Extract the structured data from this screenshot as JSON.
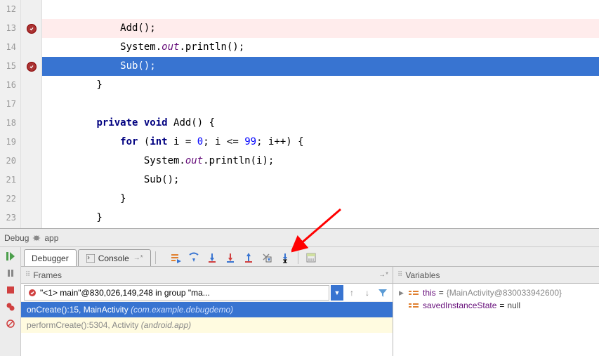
{
  "editor": {
    "lines": [
      {
        "num": 12,
        "text": ""
      },
      {
        "num": 13,
        "text": "            Add();",
        "bp": true
      },
      {
        "num": 14,
        "parts": [
          "            System.",
          {
            "it": "out"
          },
          ".println();"
        ]
      },
      {
        "num": 15,
        "text": "            Sub();",
        "bp": true,
        "exec": true
      },
      {
        "num": 16,
        "text": "        }"
      },
      {
        "num": 17,
        "text": ""
      },
      {
        "num": 18,
        "parts": [
          "        ",
          {
            "kw": "private void"
          },
          " Add() {"
        ]
      },
      {
        "num": 19,
        "parts": [
          "            ",
          {
            "kw": "for"
          },
          " (",
          {
            "kw": "int"
          },
          " i = ",
          {
            "num": "0"
          },
          "; i <= ",
          {
            "num": "99"
          },
          "; i++) {"
        ]
      },
      {
        "num": 20,
        "parts": [
          "                System.",
          {
            "it": "out"
          },
          ".println(i);"
        ]
      },
      {
        "num": 21,
        "text": "                Sub();"
      },
      {
        "num": 22,
        "text": "            }"
      },
      {
        "num": 23,
        "text": "        }"
      }
    ]
  },
  "debug": {
    "header_label": "Debug",
    "config_name": "app",
    "tabs": {
      "debugger": "Debugger",
      "console": "Console"
    },
    "frames": {
      "title": "Frames",
      "thread": "\"<1> main\"@830,026,149,248 in group \"ma...",
      "stack": [
        {
          "method": "onCreate():15, MainActivity ",
          "pkg": "(com.example.debugdemo)",
          "sel": true
        },
        {
          "method": "performCreate():5304, Activity ",
          "pkg": "(android.app)",
          "lib": true
        }
      ]
    },
    "variables": {
      "title": "Variables",
      "items": [
        {
          "name": "this",
          "val": "{MainActivity@830033942600}",
          "obj": true
        },
        {
          "name": "savedInstanceState",
          "val": "null"
        }
      ]
    }
  }
}
